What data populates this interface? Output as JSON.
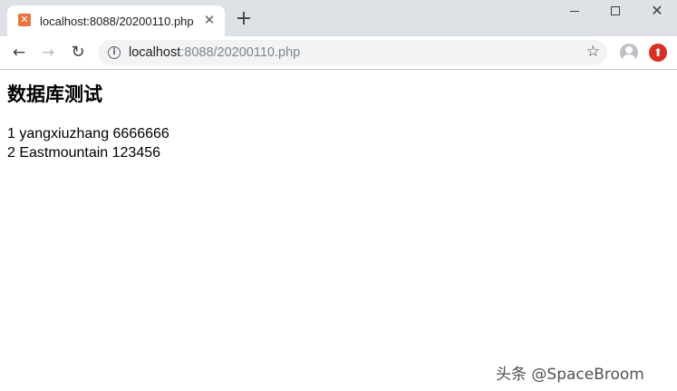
{
  "tab": {
    "title": "localhost:8088/20200110.php",
    "favicon_icon": "xampp-icon",
    "close_icon": "close-icon"
  },
  "new_tab": {
    "icon": "plus-icon"
  },
  "window_controls": {
    "minimize": "minimize-icon",
    "maximize": "maximize-icon",
    "close": "close-icon"
  },
  "toolbar": {
    "back_icon": "arrow-left-icon",
    "forward_icon": "arrow-right-icon",
    "reload_icon": "reload-icon",
    "url_host": "localhost",
    "url_rest": ":8088/20200110.php",
    "bookmark_icon": "star-icon",
    "profile_icon": "avatar-icon",
    "extension_icon": "extension-icon"
  },
  "page": {
    "heading": "数据库测试",
    "rows": [
      "1 yangxiuzhang 6666666",
      "2 Eastmountain 123456"
    ]
  },
  "watermark": "头条 @SpaceBroom",
  "colors": {
    "tabstrip": "#dee1e6",
    "omnibox": "#f1f3f4",
    "favicon": "#e8743b",
    "extension": "#d93025"
  }
}
